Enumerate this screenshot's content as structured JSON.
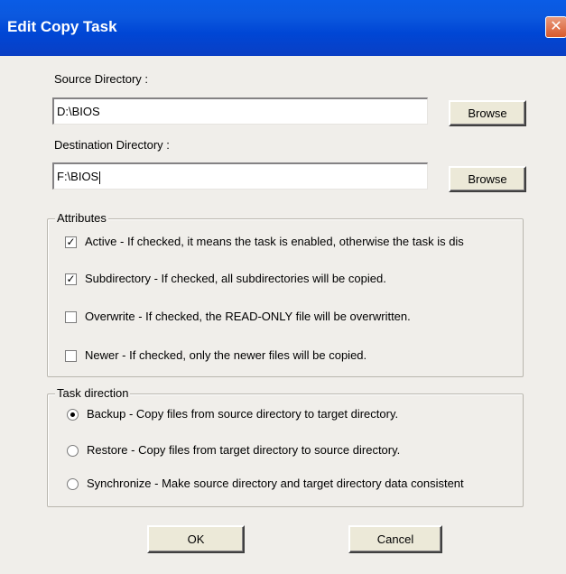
{
  "window": {
    "title": "Edit Copy Task",
    "close_glyph": "✕"
  },
  "source": {
    "label": "Source Directory :",
    "value": "D:\\BIOS",
    "browse_label": "Browse"
  },
  "destination": {
    "label": "Destination Directory :",
    "value": "F:\\BIOS",
    "browse_label": "Browse"
  },
  "attributes": {
    "legend": "Attributes",
    "items": [
      {
        "label": "Active - If checked, it means the task is enabled, otherwise the task is dis",
        "checked": true,
        "mark": "✓"
      },
      {
        "label": "Subdirectory - If checked, all subdirectories will be copied.",
        "checked": true,
        "mark": "✓"
      },
      {
        "label": "Overwrite - If checked, the READ-ONLY file will be overwritten.",
        "checked": false,
        "mark": ""
      },
      {
        "label": "Newer - If checked, only the newer files will be copied.",
        "checked": false,
        "mark": ""
      }
    ]
  },
  "task_direction": {
    "legend": "Task direction",
    "selected": "Backup",
    "items": [
      {
        "label": "Backup - Copy files from source directory to target directory."
      },
      {
        "label": "Restore - Copy files from target directory to source directory."
      },
      {
        "label": "Synchronize - Make source directory and target directory data consistent"
      }
    ]
  },
  "footer": {
    "ok_label": "OK",
    "cancel_label": "Cancel"
  }
}
